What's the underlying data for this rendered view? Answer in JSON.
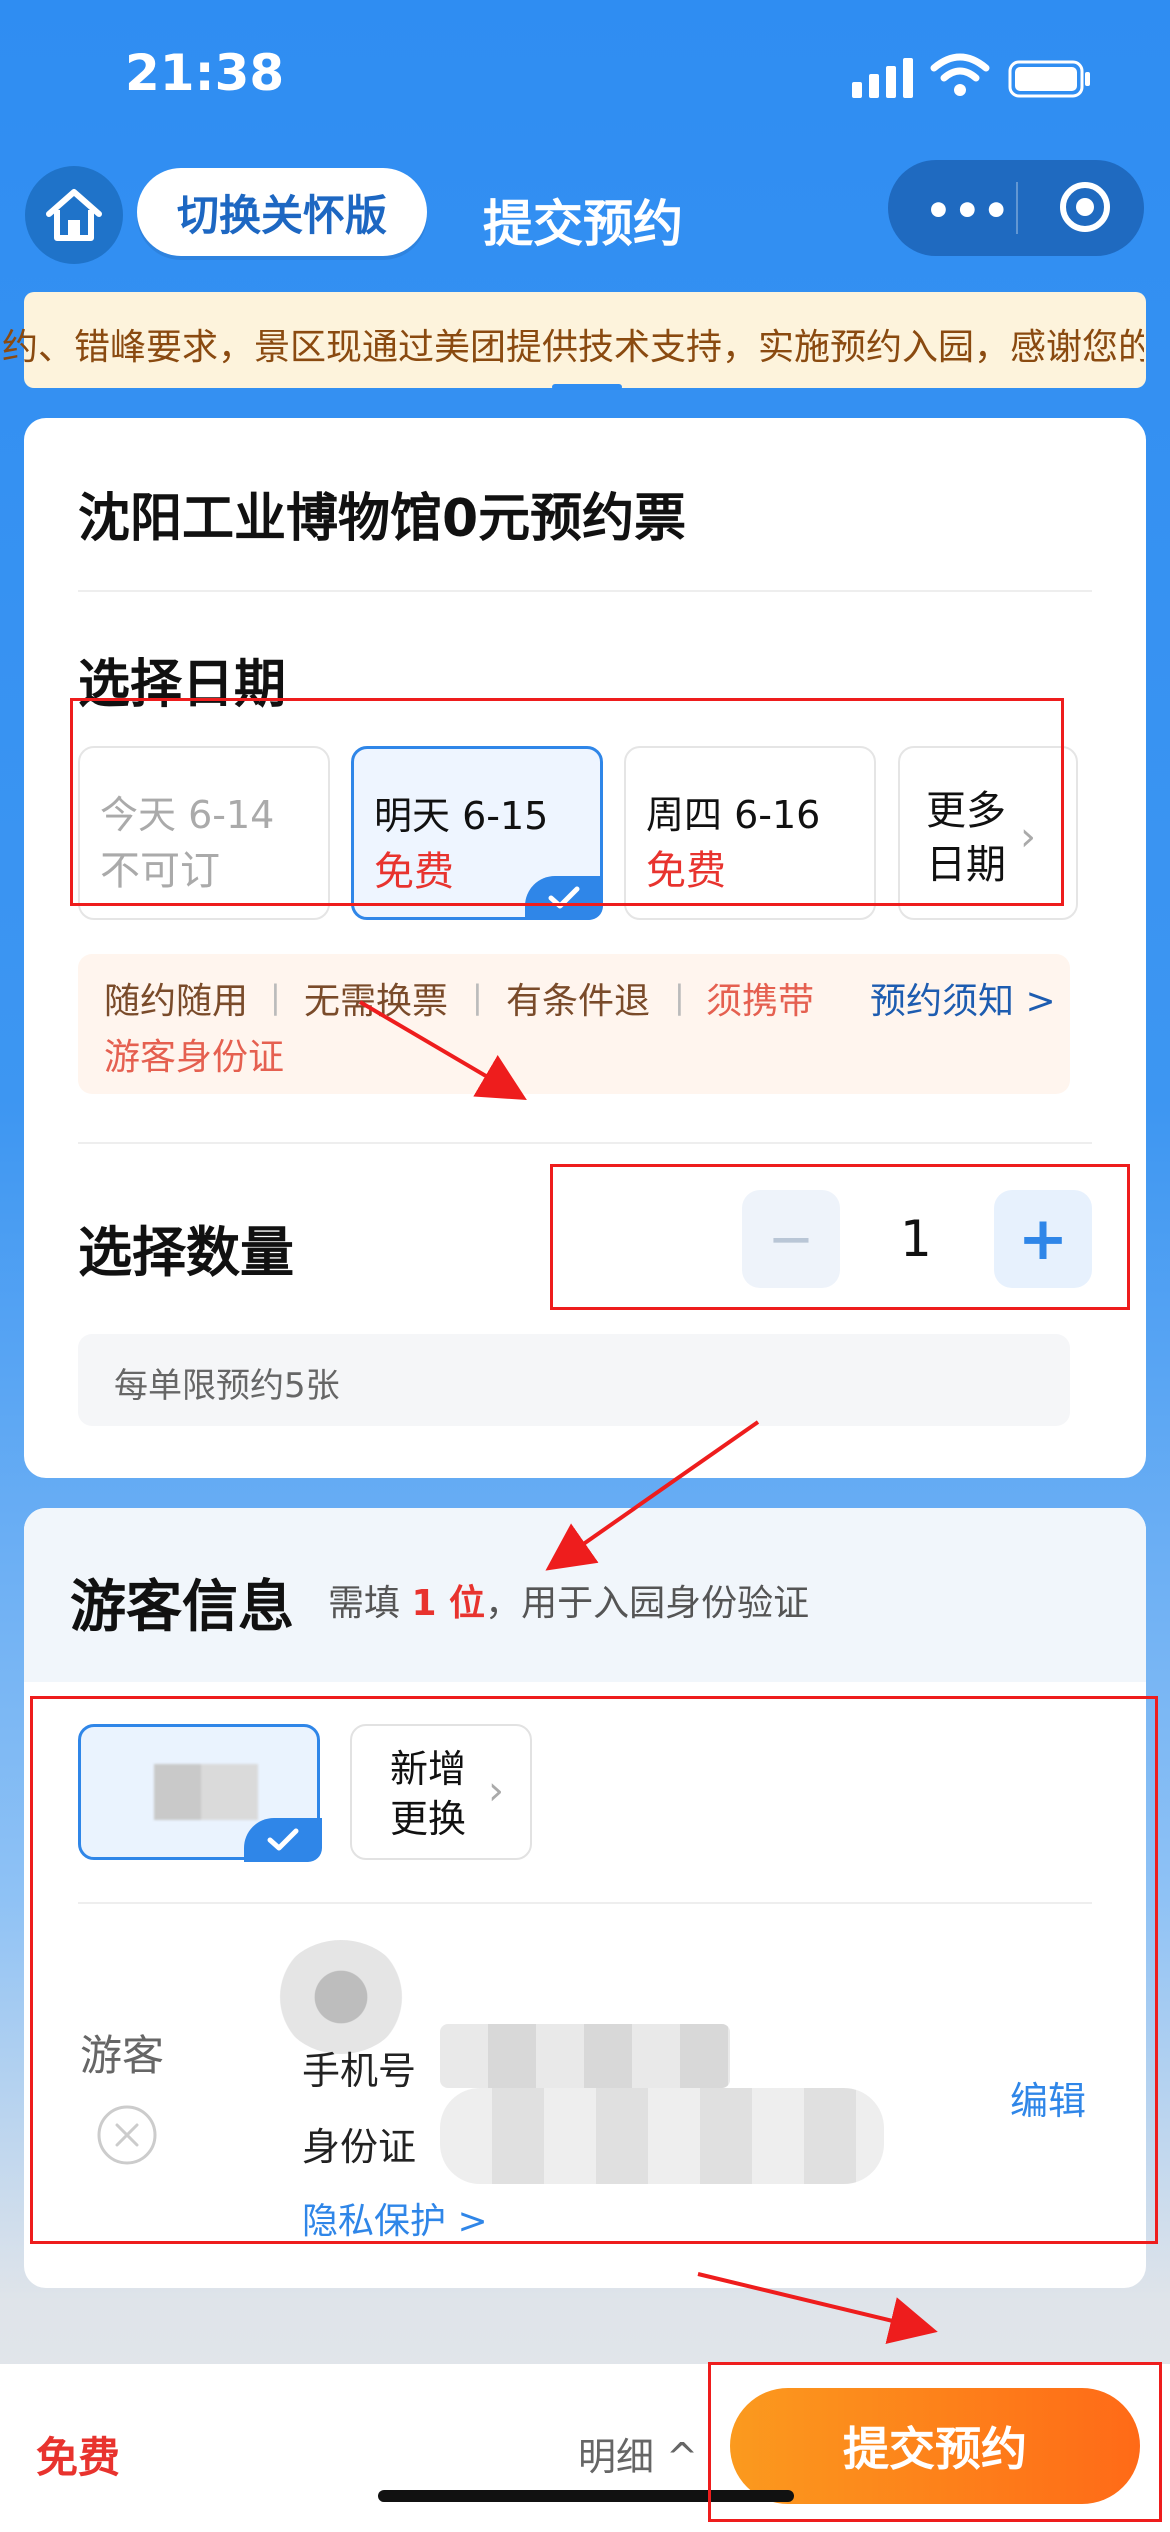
{
  "status_bar": {
    "time": "21:38"
  },
  "nav": {
    "care_mode": "切换关怀版",
    "title": "提交预约"
  },
  "notice": {
    "text": "约、错峰要求，景区现通过美团提供技术支持，实施预约入园，感谢您的"
  },
  "ticket": {
    "title": "沈阳工业博物馆0元预约票"
  },
  "date_section": {
    "title": "选择日期",
    "dates": [
      {
        "label": "今天 6-14",
        "status": "不可订"
      },
      {
        "label": "明天 6-15",
        "status": "免费"
      },
      {
        "label": "周四 6-16",
        "status": "免费"
      }
    ],
    "more": "更多日期"
  },
  "tags": {
    "t1": "随约随用",
    "t2": "无需换票",
    "t3": "有条件退",
    "t4": "须携带",
    "t4b": "游客身份证",
    "notice_link": "预约须知 >"
  },
  "quantity": {
    "title": "选择数量",
    "value": "1",
    "limit": "每单限预约5张"
  },
  "visitor": {
    "title": "游客信息",
    "note_prefix": "需填",
    "note_count": "1 位",
    "note_suffix": "，用于入园身份验证",
    "add_change": "新增更换",
    "label": "游客",
    "phone_label": "手机号",
    "id_label": "身份证",
    "privacy": "隐私保护 >",
    "edit": "编辑"
  },
  "bottom": {
    "price": "免费",
    "detail": "明细 ^",
    "submit": "提交预约"
  }
}
